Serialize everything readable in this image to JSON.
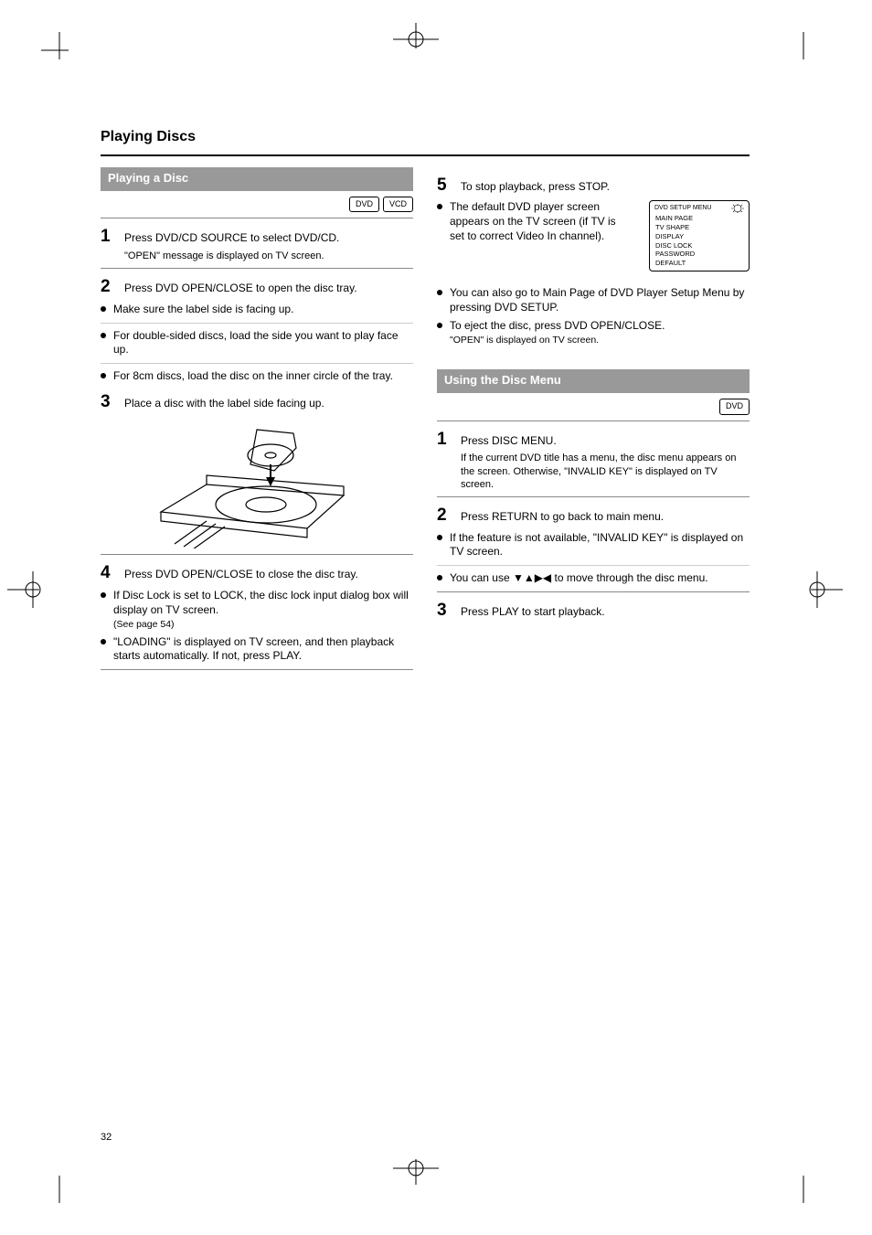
{
  "page_title": "Playing Discs",
  "page_number": "32",
  "left": {
    "section_title": "Playing a Disc",
    "badges": [
      "DVD",
      "VCD"
    ],
    "step1": {
      "text": "Press DVD/CD SOURCE to select DVD/CD.",
      "sub": "\"OPEN\" message is displayed on TV screen."
    },
    "step2": {
      "text": "Press DVD OPEN/CLOSE to open the disc tray."
    },
    "step3": {
      "text": "Place a disc with the label side facing up."
    },
    "b1": "Make sure the label side is facing up.",
    "b2": "For double-sided discs, load the side you want to play face up.",
    "b3": "For 8cm discs, load the disc on the inner circle of the tray.",
    "step4": {
      "text": "Press DVD OPEN/CLOSE to close the disc tray."
    },
    "b4": {
      "line": "If Disc Lock is set to LOCK, the disc lock input dialog box will display on TV screen.",
      "sub": "(See page 54)"
    },
    "b5": "\"LOADING\" is displayed on TV screen, and then playback starts automatically. If not, press PLAY.",
    "step5": {
      "text": "To stop playback, press STOP."
    },
    "r5b1": {
      "line": "The default DVD player screen appears on the TV screen (if TV is set to correct Video In channel).",
      "menu": {
        "title": "DVD SETUP MENU",
        "items": [
          "MAIN PAGE",
          "TV SHAPE",
          "DISPLAY",
          "DISC LOCK",
          "PASSWORD",
          "DEFAULT"
        ]
      }
    },
    "r5b2": "You can also go to Main Page of DVD Player Setup Menu by pressing DVD SETUP.",
    "r5b3": {
      "line": "To eject the disc, press DVD OPEN/CLOSE.",
      "sub": "\"OPEN\" is displayed on TV screen."
    }
  },
  "right": {
    "section_title": "Using the Disc Menu",
    "badge": "DVD",
    "step1": {
      "text": "Press DISC MENU.",
      "sub": "If the current DVD title has a menu, the disc menu appears on the screen. Otherwise, \"INVALID KEY\" is displayed on TV screen."
    },
    "step2": {
      "text": "Press RETURN to go back to main menu."
    },
    "b1": "If the feature is not available, \"INVALID KEY\" is displayed on TV screen.",
    "b2": "You can use ▼▲▶◀ to move through the disc menu.",
    "step3": {
      "text": "Press PLAY to start playback."
    }
  }
}
